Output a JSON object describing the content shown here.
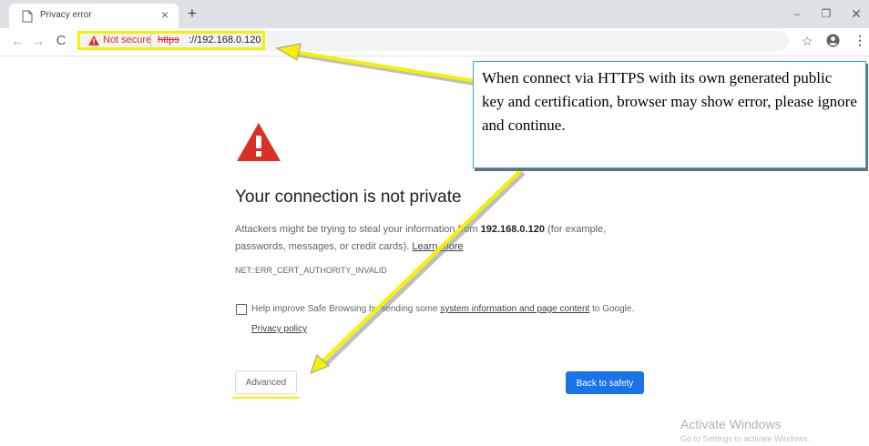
{
  "browser": {
    "tab_title": "Privacy error",
    "tab_close": "×",
    "new_tab": "+",
    "window_controls": {
      "minimize": "–",
      "maximize": "❐",
      "close": "✕"
    },
    "nav": {
      "back": "←",
      "forward": "→",
      "reload": "C"
    },
    "address_bar": {
      "security_label": "Not secure",
      "url_scheme": "https",
      "url_rest": "://192.168.0.120"
    },
    "icons": [
      "page-icon",
      "warning-icon",
      "star-icon",
      "profile-icon",
      "menu-icon"
    ],
    "bookmark": "☆",
    "menu": "⋮"
  },
  "page": {
    "title": "Your connection is not private",
    "paragraph": {
      "before_host": "Attackers might be trying to steal your information from ",
      "host": "192.168.0.120",
      "after_host": " (for example, passwords, messages, or credit cards). ",
      "learn_more": "Learn more"
    },
    "error_code": "NET::ERR_CERT_AUTHORITY_INVALID",
    "safe_browsing": {
      "before_link": "Help improve Safe Browsing by sending some ",
      "link": "system information and page content",
      "after_link": " to Google.",
      "privacy_policy": "Privacy policy"
    },
    "advanced_button": "Advanced",
    "back_to_safety_button": "Back to safety"
  },
  "annotation": {
    "callout_text": "When connect via HTTPS with its own generated public key and certification, browser may show error, please ignore and continue.",
    "highlight_color": "#f7f000",
    "border_color": "#2aa7d9"
  },
  "watermark": {
    "title": "Activate Windows",
    "subtitle": "Go to Settings to activate Windows."
  },
  "colors": {
    "danger": "#d93025",
    "primary_button": "#1a73e8",
    "warning_triangle": "#d93025"
  }
}
